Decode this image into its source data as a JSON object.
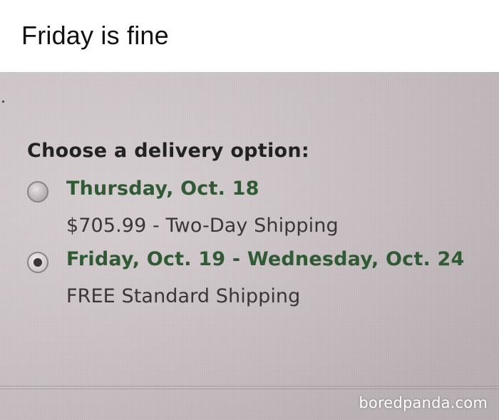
{
  "caption": {
    "text": "Friday is fine"
  },
  "delivery": {
    "heading": "Choose a delivery option:",
    "options": [
      {
        "date": "Thursday, Oct. 18",
        "price_line": "$705.99 - Two-Day Shipping",
        "selected": false
      },
      {
        "date": "Friday, Oct. 19 - Wednesday, Oct. 24",
        "price_line": "FREE Standard Shipping",
        "selected": true
      }
    ]
  },
  "colors": {
    "option_date": "#2f5a33",
    "heading": "#222222",
    "background": "#d3cacd"
  },
  "watermark": {
    "text": "boredpanda.com"
  }
}
